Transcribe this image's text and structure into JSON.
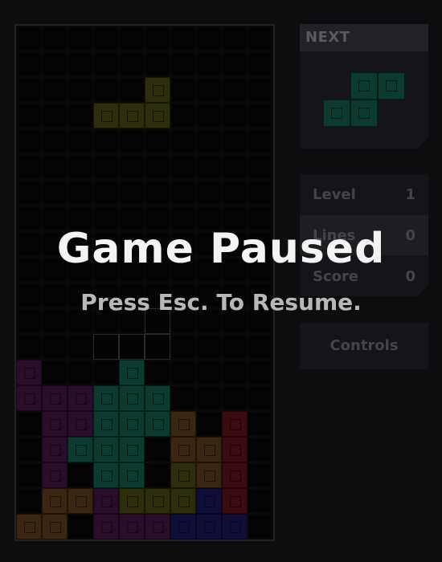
{
  "next": {
    "label": "NEXT",
    "piece": "S",
    "color": "#0b3a2e",
    "cells": [
      [
        0,
        1
      ],
      [
        0,
        2
      ],
      [
        1,
        0
      ],
      [
        1,
        1
      ]
    ]
  },
  "stats": {
    "level_label": "Level",
    "level_value": "1",
    "lines_label": "Lines",
    "lines_value": "0",
    "score_label": "Score",
    "score_value": "0"
  },
  "controls_label": "Controls",
  "overlay": {
    "title": "Game Paused",
    "subtitle": "Press Esc. To Resume."
  },
  "board": {
    "cols": 10,
    "rows": 20,
    "colors": {
      "J": "#2a0d2b",
      "S": "#0b3a2e",
      "Z": "#3a0b10",
      "O": "#3a2610",
      "L": "#2d2d09",
      "I": "#0e0e38",
      "T": "#3a2610"
    },
    "active_piece": {
      "type": "L",
      "cells": [
        [
          2,
          5
        ],
        [
          3,
          3
        ],
        [
          3,
          4
        ],
        [
          3,
          5
        ]
      ]
    },
    "ghost_cells": [
      [
        11,
        5
      ],
      [
        12,
        3
      ],
      [
        12,
        4
      ],
      [
        12,
        5
      ]
    ],
    "locked": [
      [
        13,
        0,
        "J"
      ],
      [
        13,
        4,
        "S"
      ],
      [
        14,
        0,
        "J"
      ],
      [
        14,
        1,
        "J"
      ],
      [
        14,
        2,
        "J"
      ],
      [
        14,
        3,
        "S"
      ],
      [
        14,
        4,
        "S"
      ],
      [
        14,
        5,
        "S"
      ],
      [
        15,
        1,
        "J"
      ],
      [
        15,
        2,
        "J"
      ],
      [
        15,
        3,
        "S"
      ],
      [
        15,
        4,
        "S"
      ],
      [
        15,
        5,
        "S"
      ],
      [
        15,
        6,
        "O"
      ],
      [
        15,
        8,
        "Z"
      ],
      [
        16,
        1,
        "J"
      ],
      [
        16,
        2,
        "S"
      ],
      [
        16,
        3,
        "S"
      ],
      [
        16,
        4,
        "S"
      ],
      [
        16,
        6,
        "O"
      ],
      [
        16,
        7,
        "O"
      ],
      [
        16,
        8,
        "Z"
      ],
      [
        17,
        1,
        "J"
      ],
      [
        17,
        3,
        "S"
      ],
      [
        17,
        4,
        "S"
      ],
      [
        17,
        6,
        "L"
      ],
      [
        17,
        7,
        "O"
      ],
      [
        17,
        8,
        "Z"
      ],
      [
        18,
        1,
        "O"
      ],
      [
        18,
        2,
        "O"
      ],
      [
        18,
        3,
        "J"
      ],
      [
        18,
        4,
        "L"
      ],
      [
        18,
        5,
        "L"
      ],
      [
        18,
        6,
        "L"
      ],
      [
        18,
        7,
        "I"
      ],
      [
        18,
        8,
        "Z"
      ],
      [
        19,
        0,
        "O"
      ],
      [
        19,
        1,
        "O"
      ],
      [
        19,
        3,
        "J"
      ],
      [
        19,
        4,
        "J"
      ],
      [
        19,
        5,
        "J"
      ],
      [
        19,
        6,
        "I"
      ],
      [
        19,
        7,
        "I"
      ],
      [
        19,
        8,
        "I"
      ]
    ]
  }
}
